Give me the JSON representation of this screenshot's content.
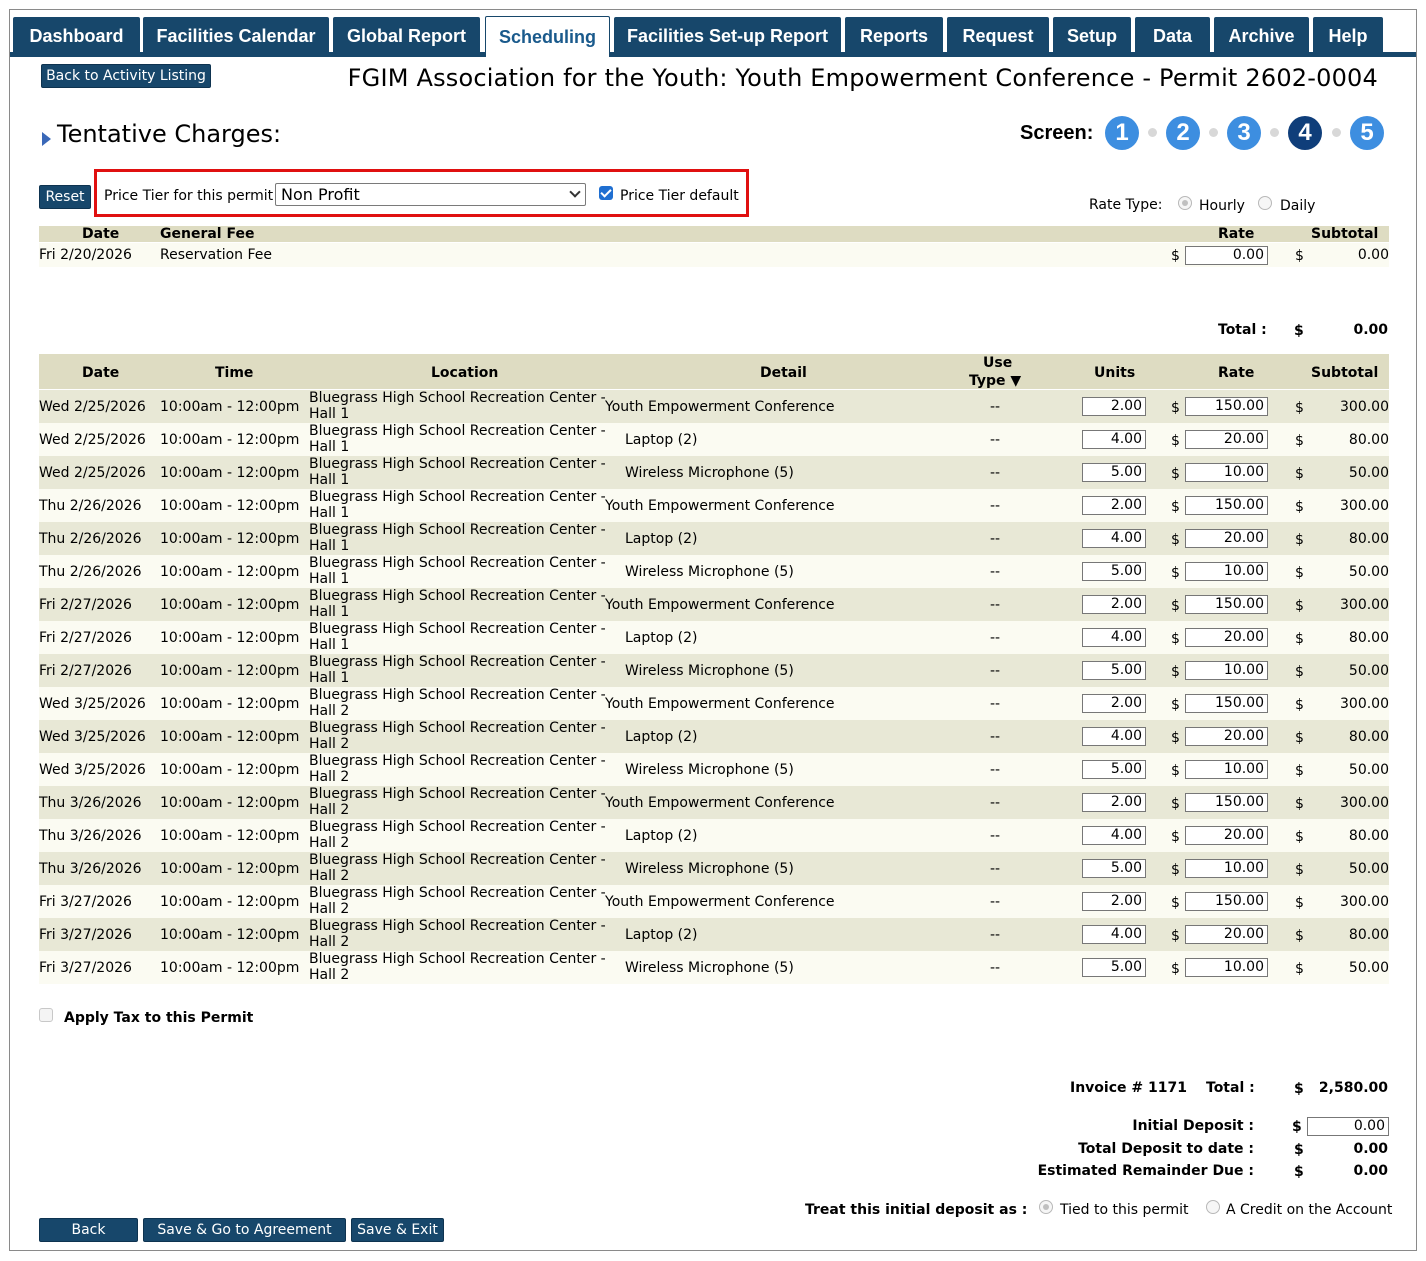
{
  "nav": {
    "tabs": [
      {
        "label": "Dashboard"
      },
      {
        "label": "Facilities Calendar"
      },
      {
        "label": "Global Report"
      },
      {
        "label": "Scheduling"
      },
      {
        "label": "Facilities Set-up Report"
      },
      {
        "label": "Reports"
      },
      {
        "label": "Request"
      },
      {
        "label": "Setup"
      },
      {
        "label": "Data"
      },
      {
        "label": "Archive"
      },
      {
        "label": "Help"
      }
    ],
    "active": "Scheduling"
  },
  "back_to_listing": "Back to Activity Listing",
  "page_title": "FGIM Association for the Youth: Youth Empowerment Conference - Permit 2602-0004",
  "section_title": "Tentative Charges:",
  "screen": {
    "label": "Screen:",
    "steps": [
      "1",
      "2",
      "3",
      "4",
      "5"
    ],
    "current": "4"
  },
  "price_tier": {
    "reset": "Reset",
    "label": "Price Tier for this permit",
    "selected": "Non Profit",
    "default_label": "Price Tier default",
    "default_checked": true
  },
  "rate_type": {
    "label": "Rate Type:",
    "options": [
      "Hourly",
      "Daily"
    ]
  },
  "general_fees": {
    "headers": {
      "date": "Date",
      "fee": "General Fee",
      "rate": "Rate",
      "subtotal": "Subtotal"
    },
    "rows": [
      {
        "date": "Fri 2/20/2026",
        "fee": "Reservation Fee",
        "currency": "$",
        "rate": "0.00",
        "subtotal": "0.00"
      }
    ],
    "total_label": "Total :",
    "total_currency": "$",
    "total": "0.00"
  },
  "charges": {
    "headers": {
      "date": "Date",
      "time": "Time",
      "location": "Location",
      "detail": "Detail",
      "use_type_1": "Use",
      "use_type_2": "Type ▼",
      "units": "Units",
      "rate": "Rate",
      "subtotal": "Subtotal"
    },
    "rows": [
      {
        "date": "Wed 2/25/2026",
        "time": "10:00am - 12:00pm",
        "loc1": "Bluegrass High School Recreation Center -",
        "loc2": "Hall 1",
        "detail": "Youth Empowerment Conference",
        "use": "--",
        "units": "2.00",
        "cur": "$",
        "rate": "150.00",
        "sub": "300.00"
      },
      {
        "date": "Wed 2/25/2026",
        "time": "10:00am - 12:00pm",
        "loc1": "Bluegrass High School Recreation Center -",
        "loc2": "Hall 1",
        "detail": "Laptop (2)",
        "use": "--",
        "units": "4.00",
        "cur": "$",
        "rate": "20.00",
        "sub": "80.00"
      },
      {
        "date": "Wed 2/25/2026",
        "time": "10:00am - 12:00pm",
        "loc1": "Bluegrass High School Recreation Center -",
        "loc2": "Hall 1",
        "detail": "Wireless Microphone (5)",
        "use": "--",
        "units": "5.00",
        "cur": "$",
        "rate": "10.00",
        "sub": "50.00"
      },
      {
        "date": "Thu 2/26/2026",
        "time": "10:00am - 12:00pm",
        "loc1": "Bluegrass High School Recreation Center -",
        "loc2": "Hall 1",
        "detail": "Youth Empowerment Conference",
        "use": "--",
        "units": "2.00",
        "cur": "$",
        "rate": "150.00",
        "sub": "300.00"
      },
      {
        "date": "Thu 2/26/2026",
        "time": "10:00am - 12:00pm",
        "loc1": "Bluegrass High School Recreation Center -",
        "loc2": "Hall 1",
        "detail": "Laptop (2)",
        "use": "--",
        "units": "4.00",
        "cur": "$",
        "rate": "20.00",
        "sub": "80.00"
      },
      {
        "date": "Thu 2/26/2026",
        "time": "10:00am - 12:00pm",
        "loc1": "Bluegrass High School Recreation Center -",
        "loc2": "Hall 1",
        "detail": "Wireless Microphone (5)",
        "use": "--",
        "units": "5.00",
        "cur": "$",
        "rate": "10.00",
        "sub": "50.00"
      },
      {
        "date": "Fri 2/27/2026",
        "time": "10:00am - 12:00pm",
        "loc1": "Bluegrass High School Recreation Center -",
        "loc2": "Hall 1",
        "detail": "Youth Empowerment Conference",
        "use": "--",
        "units": "2.00",
        "cur": "$",
        "rate": "150.00",
        "sub": "300.00"
      },
      {
        "date": "Fri 2/27/2026",
        "time": "10:00am - 12:00pm",
        "loc1": "Bluegrass High School Recreation Center -",
        "loc2": "Hall 1",
        "detail": "Laptop (2)",
        "use": "--",
        "units": "4.00",
        "cur": "$",
        "rate": "20.00",
        "sub": "80.00"
      },
      {
        "date": "Fri 2/27/2026",
        "time": "10:00am - 12:00pm",
        "loc1": "Bluegrass High School Recreation Center -",
        "loc2": "Hall 1",
        "detail": "Wireless Microphone (5)",
        "use": "--",
        "units": "5.00",
        "cur": "$",
        "rate": "10.00",
        "sub": "50.00"
      },
      {
        "date": "Wed 3/25/2026",
        "time": "10:00am - 12:00pm",
        "loc1": "Bluegrass High School Recreation Center -",
        "loc2": "Hall 2",
        "detail": "Youth Empowerment Conference",
        "use": "--",
        "units": "2.00",
        "cur": "$",
        "rate": "150.00",
        "sub": "300.00"
      },
      {
        "date": "Wed 3/25/2026",
        "time": "10:00am - 12:00pm",
        "loc1": "Bluegrass High School Recreation Center -",
        "loc2": "Hall 2",
        "detail": "Laptop (2)",
        "use": "--",
        "units": "4.00",
        "cur": "$",
        "rate": "20.00",
        "sub": "80.00"
      },
      {
        "date": "Wed 3/25/2026",
        "time": "10:00am - 12:00pm",
        "loc1": "Bluegrass High School Recreation Center -",
        "loc2": "Hall 2",
        "detail": "Wireless Microphone (5)",
        "use": "--",
        "units": "5.00",
        "cur": "$",
        "rate": "10.00",
        "sub": "50.00"
      },
      {
        "date": "Thu 3/26/2026",
        "time": "10:00am - 12:00pm",
        "loc1": "Bluegrass High School Recreation Center -",
        "loc2": "Hall 2",
        "detail": "Youth Empowerment Conference",
        "use": "--",
        "units": "2.00",
        "cur": "$",
        "rate": "150.00",
        "sub": "300.00"
      },
      {
        "date": "Thu 3/26/2026",
        "time": "10:00am - 12:00pm",
        "loc1": "Bluegrass High School Recreation Center -",
        "loc2": "Hall 2",
        "detail": "Laptop (2)",
        "use": "--",
        "units": "4.00",
        "cur": "$",
        "rate": "20.00",
        "sub": "80.00"
      },
      {
        "date": "Thu 3/26/2026",
        "time": "10:00am - 12:00pm",
        "loc1": "Bluegrass High School Recreation Center -",
        "loc2": "Hall 2",
        "detail": "Wireless Microphone (5)",
        "use": "--",
        "units": "5.00",
        "cur": "$",
        "rate": "10.00",
        "sub": "50.00"
      },
      {
        "date": "Fri 3/27/2026",
        "time": "10:00am - 12:00pm",
        "loc1": "Bluegrass High School Recreation Center -",
        "loc2": "Hall 2",
        "detail": "Youth Empowerment Conference",
        "use": "--",
        "units": "2.00",
        "cur": "$",
        "rate": "150.00",
        "sub": "300.00"
      },
      {
        "date": "Fri 3/27/2026",
        "time": "10:00am - 12:00pm",
        "loc1": "Bluegrass High School Recreation Center -",
        "loc2": "Hall 2",
        "detail": "Laptop (2)",
        "use": "--",
        "units": "4.00",
        "cur": "$",
        "rate": "20.00",
        "sub": "80.00"
      },
      {
        "date": "Fri 3/27/2026",
        "time": "10:00am - 12:00pm",
        "loc1": "Bluegrass High School Recreation Center -",
        "loc2": "Hall 2",
        "detail": "Wireless Microphone (5)",
        "use": "--",
        "units": "5.00",
        "cur": "$",
        "rate": "10.00",
        "sub": "50.00"
      }
    ]
  },
  "tax": {
    "label": "Apply Tax to this Permit",
    "checked": false
  },
  "summary": {
    "invoice_label": "Invoice # 1171",
    "total_label": "Total :",
    "total_currency": "$",
    "total": "2,580.00",
    "initial_deposit_label": "Initial Deposit :",
    "initial_deposit_currency": "$",
    "initial_deposit": "0.00",
    "deposit_to_date_label": "Total Deposit to date :",
    "deposit_to_date_currency": "$",
    "deposit_to_date": "0.00",
    "remainder_label": "Estimated Remainder Due :",
    "remainder_currency": "$",
    "remainder": "0.00",
    "treat_label": "Treat this initial deposit as :",
    "treat_options": [
      "Tied to this permit",
      "A Credit on the Account"
    ]
  },
  "footer_buttons": {
    "back": "Back",
    "save_agreement": "Save & Go to Agreement",
    "save_exit": "Save & Exit"
  }
}
